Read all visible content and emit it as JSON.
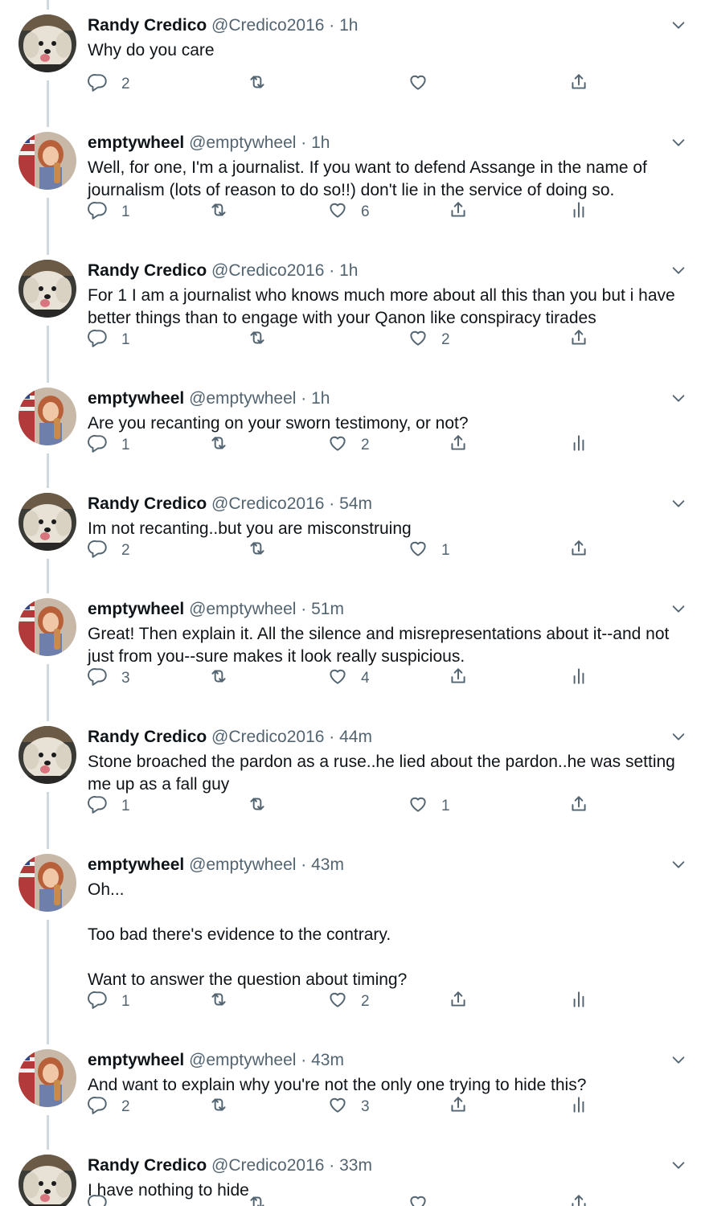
{
  "colors": {
    "text": "#0f1419",
    "secondary": "#536471",
    "thread_line": "#cfd9de",
    "background": "#ffffff"
  },
  "tweets": [
    {
      "name": "Randy Credico",
      "handle": "@Credico2016",
      "time": "1h",
      "text": "Why do you care",
      "replies": "2",
      "retweets": "",
      "likes": "",
      "analytics": false,
      "avatar": "dog-avatar"
    },
    {
      "name": "emptywheel",
      "handle": "@emptywheel",
      "time": "1h",
      "text": "Well, for one, I'm a journalist. If you want to defend Assange in the name of journalism (lots of reason to do so!!) don't lie in the service of doing so.",
      "replies": "1",
      "retweets": "",
      "likes": "6",
      "analytics": true,
      "avatar": "woman-avatar"
    },
    {
      "name": "Randy Credico",
      "handle": "@Credico2016",
      "time": "1h",
      "text": "For 1 I am a journalist who knows much more about all this than you but i have better things than to engage with your Qanon like conspiracy tirades",
      "replies": "1",
      "retweets": "",
      "likes": "2",
      "analytics": false,
      "avatar": "dog-avatar"
    },
    {
      "name": "emptywheel",
      "handle": "@emptywheel",
      "time": "1h",
      "text": "Are you recanting on your sworn testimony, or not?",
      "replies": "1",
      "retweets": "",
      "likes": "2",
      "analytics": true,
      "avatar": "woman-avatar"
    },
    {
      "name": "Randy Credico",
      "handle": "@Credico2016",
      "time": "54m",
      "text": "Im not recanting..but you are misconstruing",
      "replies": "2",
      "retweets": "",
      "likes": "1",
      "analytics": false,
      "avatar": "dog-avatar"
    },
    {
      "name": "emptywheel",
      "handle": "@emptywheel",
      "time": "51m",
      "text": "Great! Then explain it. All the silence and misrepresentations about it--and not just from you--sure makes it look really suspicious.",
      "replies": "3",
      "retweets": "",
      "likes": "4",
      "analytics": true,
      "avatar": "woman-avatar"
    },
    {
      "name": "Randy Credico",
      "handle": "@Credico2016",
      "time": "44m",
      "text": "Stone broached the pardon as a ruse..he lied about the pardon..he was setting me up as a fall guy",
      "replies": "1",
      "retweets": "",
      "likes": "1",
      "analytics": false,
      "avatar": "dog-avatar"
    },
    {
      "name": "emptywheel",
      "handle": "@emptywheel",
      "time": "43m",
      "text": "Oh...\n\nToo bad there's evidence to the contrary.\n\nWant to answer the question about timing?",
      "replies": "1",
      "retweets": "",
      "likes": "2",
      "analytics": true,
      "avatar": "woman-avatar"
    },
    {
      "name": "emptywheel",
      "handle": "@emptywheel",
      "time": "43m",
      "text": "And want to explain why you're not the only one trying to hide this?",
      "replies": "2",
      "retweets": "",
      "likes": "3",
      "analytics": true,
      "avatar": "woman-avatar"
    },
    {
      "name": "Randy Credico",
      "handle": "@Credico2016",
      "time": "33m",
      "text": "I have nothing to hide",
      "replies": "",
      "retweets": "",
      "likes": "",
      "analytics": false,
      "avatar": "dog-avatar"
    }
  ]
}
